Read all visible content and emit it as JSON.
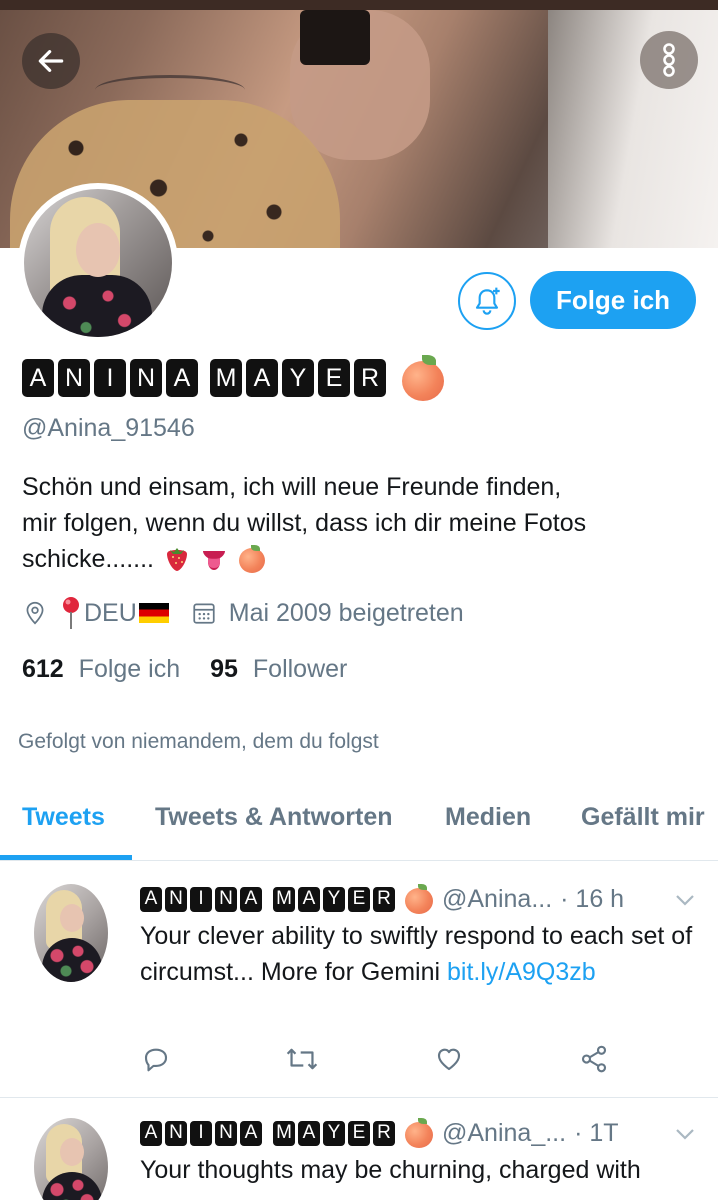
{
  "profile": {
    "name_words": [
      [
        "A",
        "N",
        "I",
        "N",
        "A"
      ],
      [
        "M",
        "A",
        "Y",
        "E",
        "R"
      ]
    ],
    "handle": "@Anina_91546",
    "bio_lines": [
      "Schön und einsam, ich will neue Freunde finden,",
      "mir folgen, wenn du willst, dass ich dir meine Fotos",
      "schicke......."
    ],
    "location": "DEU",
    "joined": "Mai 2009 beigetreten",
    "following_count": "612",
    "following_label": "Folge ich",
    "followers_count": "95",
    "followers_label": "Follower",
    "followed_by": "Gefolgt von niemandem, dem du folgst"
  },
  "buttons": {
    "follow_label": "Folge ich"
  },
  "tabs": [
    {
      "label": "Tweets",
      "active": true
    },
    {
      "label": "Tweets & Antworten",
      "active": false
    },
    {
      "label": "Medien",
      "active": false
    },
    {
      "label": "Gefällt mir",
      "active": false
    }
  ],
  "tweets": [
    {
      "handle": "@Anina...",
      "time": "· 16 h",
      "text": "Your clever ability to swiftly respond to each set of circumst... More for Gemini ",
      "link": "bit.ly/A9Q3zb"
    },
    {
      "handle": "@Anina_...",
      "time": "· 1T",
      "text": "Your thoughts may be churning, charged with",
      "link": ""
    }
  ],
  "colors": {
    "accent": "#1da1f2",
    "muted": "#657786",
    "text": "#14171a"
  },
  "icons": {
    "back": "arrow-left-icon",
    "more": "more-vertical-icon",
    "bell": "bell-plus-icon",
    "location": "location-icon",
    "calendar": "calendar-icon",
    "reply": "reply-icon",
    "retweet": "retweet-icon",
    "like": "heart-icon",
    "share": "share-icon"
  }
}
